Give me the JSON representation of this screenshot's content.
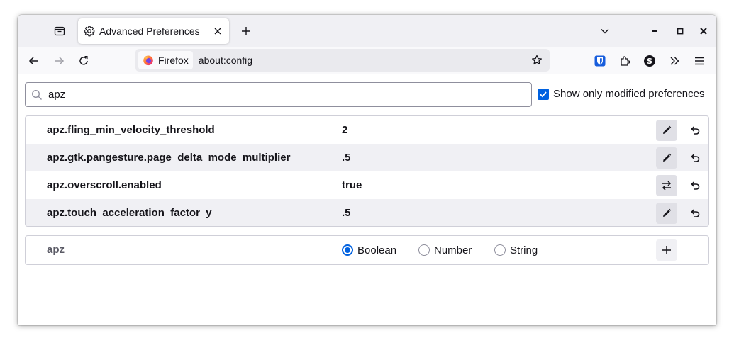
{
  "tabstrip": {
    "tab_title": "Advanced Preferences",
    "tab_icon": "gear-icon",
    "new_tab_label": "+"
  },
  "navbar": {
    "identity_label": "Firefox",
    "url": "about:config"
  },
  "search": {
    "value": "apz"
  },
  "filter": {
    "checked": true,
    "label": "Show only modified preferences"
  },
  "prefs": [
    {
      "name": "apz.fling_min_velocity_threshold",
      "value": "2",
      "action": "edit"
    },
    {
      "name": "apz.gtk.pangesture.page_delta_mode_multiplier",
      "value": ".5",
      "action": "edit"
    },
    {
      "name": "apz.overscroll.enabled",
      "value": "true",
      "action": "toggle"
    },
    {
      "name": "apz.touch_acceleration_factor_y",
      "value": ".5",
      "action": "edit"
    }
  ],
  "add_pref": {
    "name": "apz",
    "types": [
      "Boolean",
      "Number",
      "String"
    ],
    "selected": "Boolean"
  },
  "colors": {
    "accent": "#0061e0",
    "firefox_orange": "#ff7139"
  }
}
